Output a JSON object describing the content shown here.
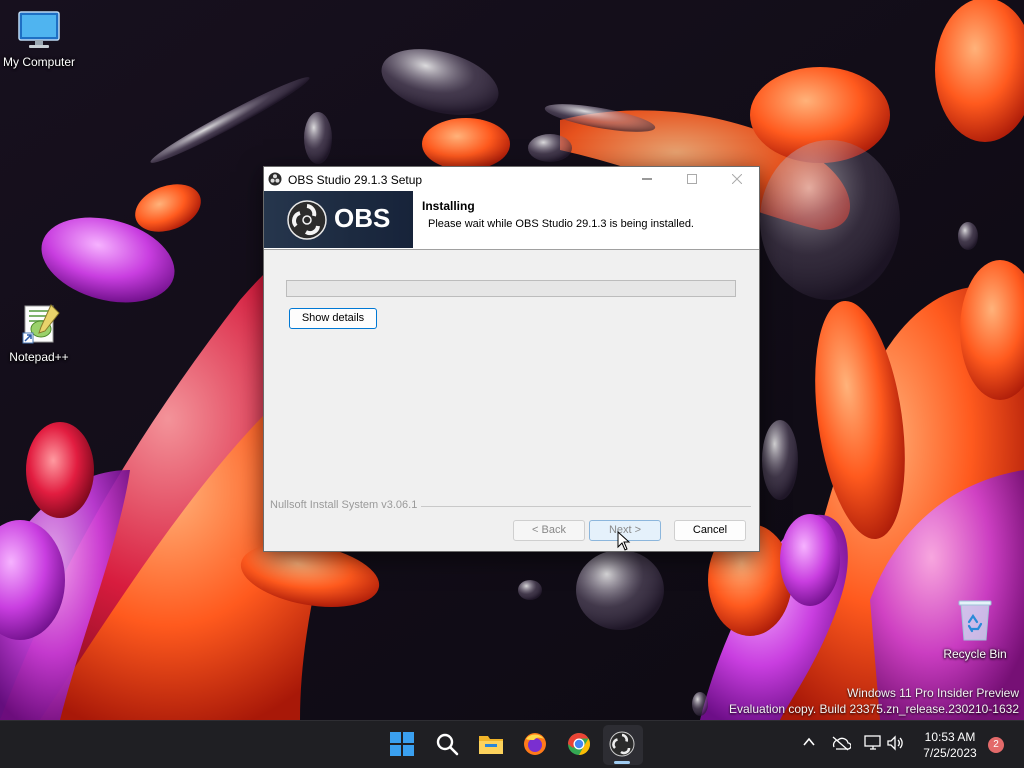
{
  "desktop": {
    "icons": [
      {
        "label": "My Computer",
        "icon": "monitor-icon"
      },
      {
        "label": "Notepad++",
        "icon": "notepadpp-icon"
      },
      {
        "label": "Recycle Bin",
        "icon": "recycle-bin-icon"
      }
    ],
    "watermark_line1": "Windows 11 Pro Insider Preview",
    "watermark_line2": "Evaluation copy. Build 23375.zn_release.230210-1632"
  },
  "setup": {
    "window_title": "OBS Studio 29.1.3 Setup",
    "banner_text": "OBS",
    "header_title": "Installing",
    "header_subtitle": "Please wait while OBS Studio 29.1.3 is being installed.",
    "progress_fraction": 0,
    "show_details_label": "Show details",
    "branding_text": "Nullsoft Install System v3.06.1",
    "back_label": "< Back",
    "next_label": "Next >",
    "cancel_label": "Cancel"
  },
  "taskbar": {
    "apps": [
      "start-icon",
      "search-icon",
      "file-explorer-icon",
      "firefox-icon",
      "chrome-icon",
      "obs-icon"
    ],
    "active_app": "obs-icon",
    "tray_icons": [
      "chevron-up-icon",
      "network-icon",
      "display-icon",
      "volume-icon"
    ],
    "time": "10:53 AM",
    "date": "7/25/2023",
    "notification_count": "2"
  },
  "colors": {
    "accent": "#0078d4",
    "obs_banner": "#1c2a40",
    "taskbar_bg": "#1f1f23"
  }
}
